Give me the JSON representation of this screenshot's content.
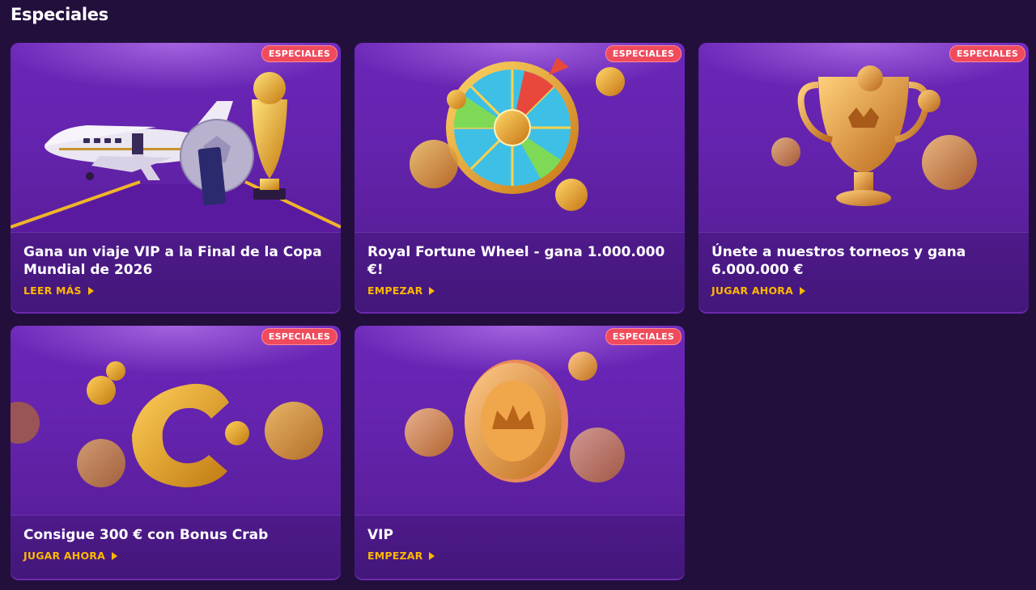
{
  "section": {
    "title": "Especiales"
  },
  "colors": {
    "background": "#230f3c",
    "card": "#4a1883",
    "badge": "#f04b5c",
    "cta": "#ffb800"
  },
  "cards": [
    {
      "badge": "ESPECIALES",
      "title": "Gana un viaje VIP a la Final de la Copa Mundial de 2026",
      "cta": "LEER MÁS",
      "art": "airplane-trophy"
    },
    {
      "badge": "ESPECIALES",
      "title": "Royal Fortune Wheel - gana 1.000.000 €!",
      "cta": "EMPEZAR",
      "art": "fortune-wheel"
    },
    {
      "badge": "ESPECIALES",
      "title": "Únete a nuestros torneos y gana 6.000.000 €",
      "cta": "JUGAR AHORA",
      "art": "trophy-coins"
    },
    {
      "badge": "ESPECIALES",
      "title": "Consigue 300 € con Bonus Crab",
      "cta": "JUGAR AHORA",
      "art": "crab-logo"
    },
    {
      "badge": "ESPECIALES",
      "title": "VIP",
      "cta": "EMPEZAR",
      "art": "vip-coin"
    }
  ]
}
